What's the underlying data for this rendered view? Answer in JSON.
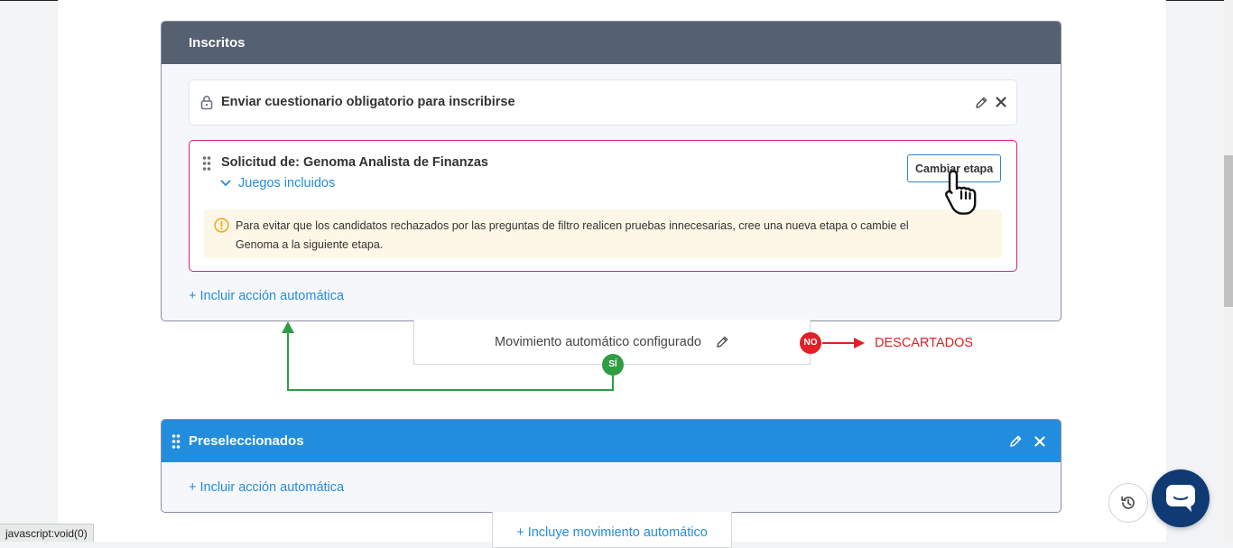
{
  "stage_inscritos": {
    "title": "Inscritos",
    "questionnaire_row": "Enviar cuestionario obligatorio para inscribirse",
    "solicitud": {
      "title": "Solicitud de: Genoma Analista de Finanzas",
      "games_link": "Juegos incluidos",
      "change_stage_button": "Cambiar etapa",
      "warning_line1": "Para evitar que los candidatos rechazados por las preguntas de filtro realicen pruebas innecesarias, cree una nueva etapa o cambie el",
      "warning_line2": "Genoma a la siguiente etapa."
    },
    "add_action_link": "+ Incluir acción automática"
  },
  "auto_movement": {
    "label": "Movimiento automático configurado",
    "yes_badge": "SÍ",
    "no_badge": "NO",
    "discarded_label": "DESCARTADOS"
  },
  "stage_preseleccionados": {
    "title": "Preseleccionados",
    "add_action_link": "+ Incluir acción automática"
  },
  "include_movement_link": "+ Incluye movimiento automático",
  "status_bar": "javascript:void(0)",
  "colors": {
    "header_dark": "#556070",
    "header_blue": "#238ddd",
    "accent_link": "#238ddd",
    "highlight_border": "#d0237a",
    "yes_green": "#2f9d43",
    "no_red": "#e11f26",
    "chat_navy": "#0f3a73"
  },
  "icons": [
    "lock-icon",
    "pencil-icon",
    "close-icon",
    "drag-handle-icon",
    "chevron-down-icon",
    "warning-icon",
    "pointer-hand-icon",
    "history-icon",
    "chat-icon",
    "arrow-right-icon",
    "arrow-up-icon"
  ]
}
